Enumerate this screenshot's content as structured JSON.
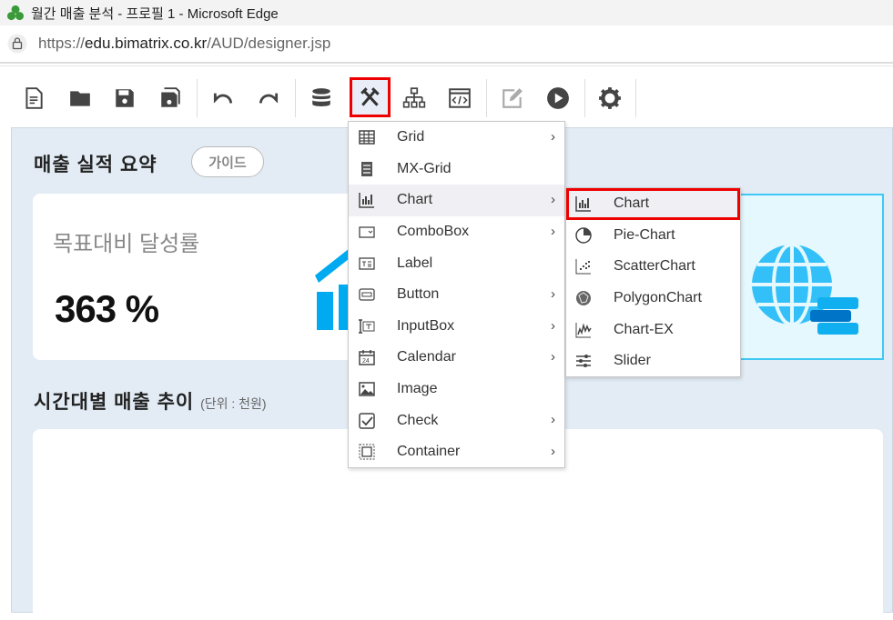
{
  "window": {
    "title": "월간 매출 분석 - 프로필 1 - Microsoft Edge"
  },
  "address": {
    "prefix": "https://",
    "domain": "edu.bimatrix.co.kr",
    "path": "/AUD/designer.jsp"
  },
  "toolbar": {
    "buttons": [
      "new-document",
      "open-folder",
      "save",
      "save-all",
      "undo",
      "redo",
      "database",
      "tools",
      "hierarchy",
      "script",
      "edit",
      "run",
      "settings"
    ]
  },
  "page": {
    "section1_title": "매출 실적 요약",
    "guide_label": "가이드",
    "kpi_label": "목표대비 달성률",
    "kpi_value": "363 %",
    "section2_title": "시간대별 매출 추이",
    "section2_unit": "(단위 : 천원)"
  },
  "menu": {
    "items": [
      {
        "label": "Grid",
        "submenu": true
      },
      {
        "label": "MX-Grid",
        "submenu": false
      },
      {
        "label": "Chart",
        "submenu": true
      },
      {
        "label": "ComboBox",
        "submenu": true
      },
      {
        "label": "Label",
        "submenu": false
      },
      {
        "label": "Button",
        "submenu": true
      },
      {
        "label": "InputBox",
        "submenu": true
      },
      {
        "label": "Calendar",
        "submenu": true
      },
      {
        "label": "Image",
        "submenu": false
      },
      {
        "label": "Check",
        "submenu": true
      },
      {
        "label": "Container",
        "submenu": true
      }
    ]
  },
  "submenu": {
    "items": [
      {
        "label": "Chart"
      },
      {
        "label": "Pie-Chart"
      },
      {
        "label": "ScatterChart"
      },
      {
        "label": "PolygonChart"
      },
      {
        "label": "Chart-EX"
      },
      {
        "label": "Slider"
      }
    ]
  },
  "colors": {
    "accent": "#00aaf0",
    "highlight": "#e00000",
    "canvas": "#e3ecf5"
  }
}
